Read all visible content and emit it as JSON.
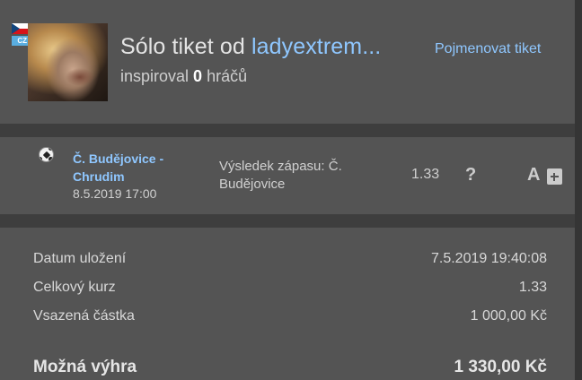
{
  "header": {
    "title_prefix": "Sólo tiket od ",
    "username": "ladyextrem...",
    "rename_link": "Pojmenovat tiket",
    "inspired_prefix": "inspiroval ",
    "inspired_count": "0",
    "inspired_suffix": " hráčů",
    "country_code": "CZ"
  },
  "match": {
    "sport_icon": "soccer-ball-icon",
    "teams": "Č. Budějovice - Chrudim",
    "datetime": "8.5.2019 17:00",
    "bet": "Výsledek zápasu: Č. Budějovice",
    "odds": "1.33",
    "status_symbol": "?",
    "extra_label": "A"
  },
  "summary": {
    "saved_label": "Datum uložení",
    "saved_value": "7.5.2019 19:40:08",
    "total_odds_label": "Celkový kurz",
    "total_odds_value": "1.33",
    "stake_label": "Vsazená částka",
    "stake_value": "1 000,00 Kč",
    "win_label": "Možná výhra",
    "win_value": "1 330,00 Kč"
  },
  "colors": {
    "background": "#3e3e3e",
    "panel": "#545454",
    "link": "#8fc7ff"
  }
}
